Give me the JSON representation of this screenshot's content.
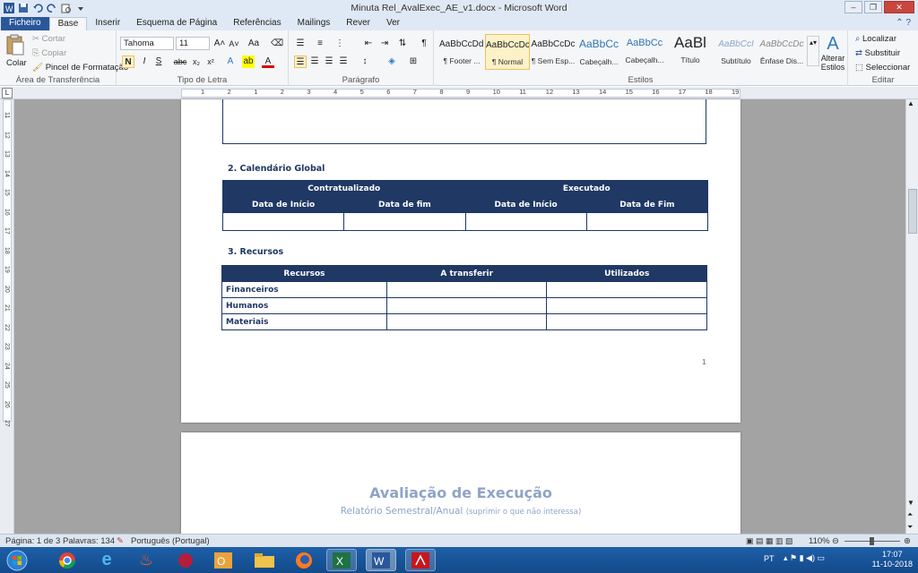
{
  "window": {
    "title": "Minuta Rel_AvalExec_AE_v1.docx - Microsoft Word"
  },
  "tabs": [
    "Ficheiro",
    "Base",
    "Inserir",
    "Esquema de Página",
    "Referências",
    "Mailings",
    "Rever",
    "Ver"
  ],
  "clipboard": {
    "paste": "Colar",
    "cut": "Cortar",
    "copy": "Copiar",
    "format_painter": "Pincel de Formatação",
    "label": "Área de Transferência"
  },
  "font": {
    "name": "Tahoma",
    "size": "11",
    "bold": "N",
    "italic": "I",
    "underline": "S",
    "strike": "abc",
    "label": "Tipo de Letra"
  },
  "paragraph": {
    "label": "Parágrafo"
  },
  "styles": {
    "label": "Estilos",
    "items": [
      {
        "preview": "AaBbCcDdI",
        "name": "¶ Footer ..."
      },
      {
        "preview": "AaBbCcDc",
        "name": "¶ Normal"
      },
      {
        "preview": "AaBbCcDc",
        "name": "¶ Sem Esp..."
      },
      {
        "preview": "AaBbCc",
        "name": "Cabeçalh..."
      },
      {
        "preview": "AaBbCc",
        "name": "Cabeçalh..."
      },
      {
        "preview": "AaBl",
        "name": "Título"
      },
      {
        "preview": "AaBbCcI",
        "name": "Subtítulo"
      },
      {
        "preview": "AaBbCcDc",
        "name": "Ênfase Dis..."
      }
    ],
    "change": "Alterar Estilos"
  },
  "editing": {
    "find": "Localizar",
    "replace": "Substituir",
    "select": "Seleccionar",
    "label": "Editar"
  },
  "ruler": {
    "numbers": [
      "1",
      "2",
      "1",
      "2",
      "3",
      "4",
      "5",
      "6",
      "7",
      "8",
      "9",
      "10",
      "11",
      "12",
      "13",
      "14",
      "15",
      "16",
      "17",
      "18",
      "19"
    ]
  },
  "vruler": {
    "numbers": [
      "11",
      "12",
      "13",
      "14",
      "15",
      "16",
      "17",
      "18",
      "19",
      "20",
      "21",
      "22",
      "23",
      "24",
      "25",
      "26",
      "27"
    ]
  },
  "doc": {
    "section2": "2. Calendário Global",
    "t1": {
      "contract": "Contratualizado",
      "executed": "Executado",
      "cols": [
        "Data de Início",
        "Data de fim",
        "Data de Início",
        "Data de Fim"
      ]
    },
    "section3": "3. Recursos",
    "t2": {
      "cols": [
        "Recursos",
        "A transferir",
        "Utilizados"
      ],
      "rows": [
        "Financeiros",
        "Humanos",
        "Materiais"
      ]
    },
    "page_number": "1",
    "page2_title": "Avaliação de Execução",
    "page2_subtitle": "Relatório Semestral/Anual",
    "page2_note": "(suprimir o que não interessa)"
  },
  "status": {
    "page": "Página: 1 de 3",
    "words": "Palavras: 134",
    "language": "Português (Portugal)",
    "zoom": "110%"
  },
  "taskbar": {
    "lang": "PT",
    "time": "17:07",
    "date": "11-10-2018"
  }
}
